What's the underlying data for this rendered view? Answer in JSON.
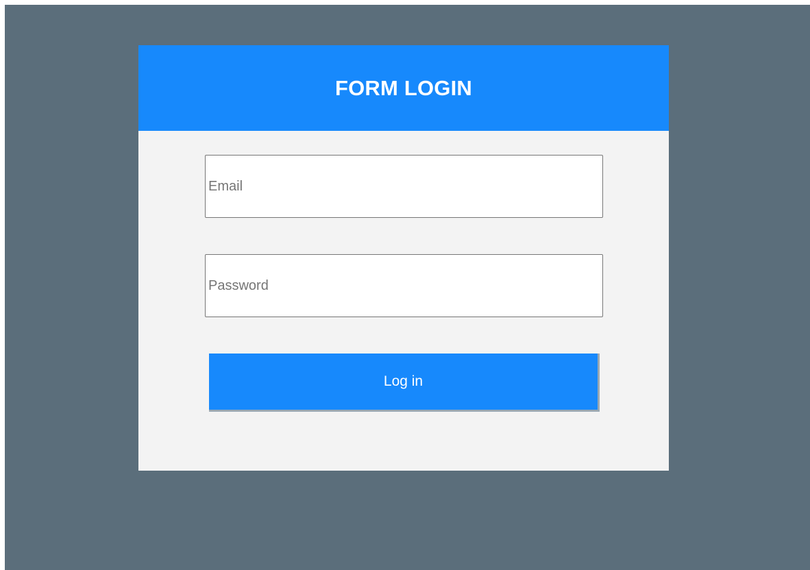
{
  "form": {
    "title": "FORM LOGIN",
    "email_placeholder": "Email",
    "password_placeholder": "Password",
    "login_label": "Log in"
  },
  "colors": {
    "background": "#5b6e7b",
    "card": "#f3f3f3",
    "accent": "#1789fc",
    "text_on_accent": "#ffffff"
  }
}
